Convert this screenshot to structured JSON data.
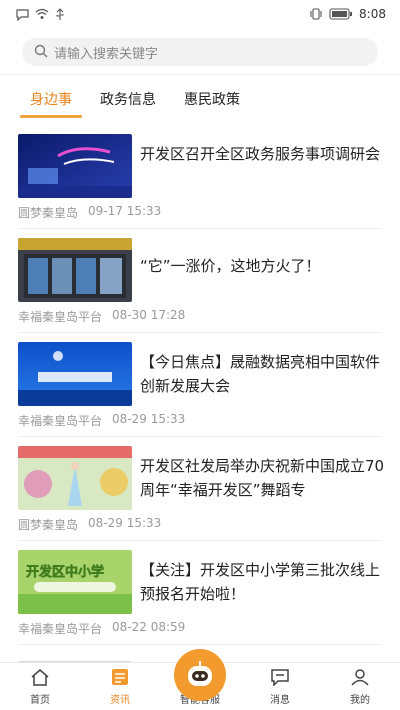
{
  "status_bar": {
    "time": "8:08"
  },
  "search": {
    "placeholder": "请输入搜索关键字"
  },
  "tabs": [
    {
      "label": "身边事",
      "active": true
    },
    {
      "label": "政务信息",
      "active": false
    },
    {
      "label": "惠民政策",
      "active": false
    }
  ],
  "news": [
    {
      "title": "开发区召开全区政务服务事项调研会",
      "source": "圆梦秦皇岛",
      "time": "09-17 15:33"
    },
    {
      "title": "“它”一涨价，这地方火了！",
      "source": "幸福秦皇岛平台",
      "time": "08-30 17:28"
    },
    {
      "title": "【今日焦点】晟融数据亮相中国软件创新发展大会",
      "source": "幸福秦皇岛平台",
      "time": "08-29 15:33"
    },
    {
      "title": "开发区社发局举办庆祝新中国成立70周年“幸福开发区”舞蹈专",
      "source": "圆梦秦皇岛",
      "time": "08-29 15:33"
    },
    {
      "title": "【关注】开发区中小学第三批次线上预报名开始啦！",
      "source": "幸福秦皇岛平台",
      "time": "08-22 08:59"
    }
  ],
  "bottom_nav": [
    {
      "label": "首页",
      "icon": "home-icon"
    },
    {
      "label": "资讯",
      "icon": "news-icon",
      "active": true
    },
    {
      "label": "智能客服",
      "icon": "robot-icon"
    },
    {
      "label": "消息",
      "icon": "message-icon"
    },
    {
      "label": "我的",
      "icon": "user-icon"
    }
  ],
  "colors": {
    "accent": "#e8841e",
    "tab_underline": "#f0a23b",
    "meta": "#9a9a9a"
  }
}
